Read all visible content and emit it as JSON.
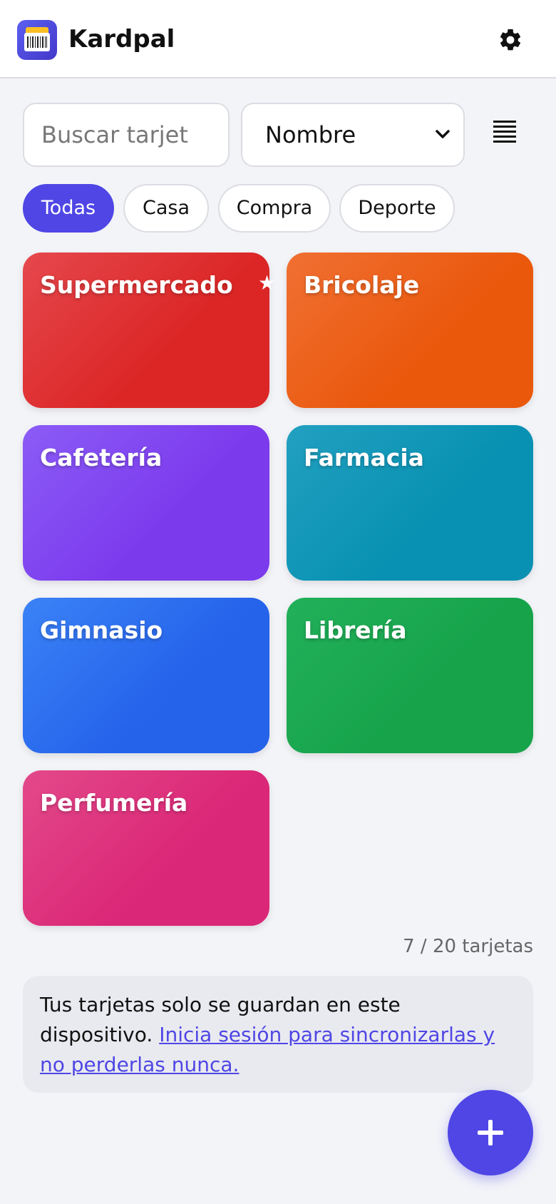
{
  "header": {
    "app_title": "Kardpal",
    "logo_icon": "wallet-card-icon",
    "settings_icon": "gear-icon"
  },
  "search": {
    "placeholder": "Buscar tarjet"
  },
  "sort": {
    "selected": "Nombre"
  },
  "view_toggle_icon": "list-view-icon",
  "filters": [
    {
      "label": "Todas",
      "active": true
    },
    {
      "label": "Casa",
      "active": false
    },
    {
      "label": "Compra",
      "active": false
    },
    {
      "label": "Deporte",
      "active": false
    }
  ],
  "cards": [
    {
      "name": "Supermercado",
      "favorite": true,
      "color_from": "#e5484d",
      "color_to": "#dc2626"
    },
    {
      "name": "Bricolaje",
      "favorite": false,
      "color_from": "#f07033",
      "color_to": "#ea580c"
    },
    {
      "name": "Cafetería",
      "favorite": false,
      "color_from": "#8b5cf6",
      "color_to": "#7c3aed"
    },
    {
      "name": "Farmacia",
      "favorite": false,
      "color_from": "#22a0c0",
      "color_to": "#0891b2"
    },
    {
      "name": "Gimnasio",
      "favorite": false,
      "color_from": "#3b82f6",
      "color_to": "#2563eb"
    },
    {
      "name": "Librería",
      "favorite": false,
      "color_from": "#22b05a",
      "color_to": "#16a34a"
    },
    {
      "name": "Perfumería",
      "favorite": false,
      "color_from": "#e3498a",
      "color_to": "#db2777"
    }
  ],
  "favorite_symbol": "★",
  "count_text": "7 / 20 tarjetas",
  "notice": {
    "text": "Tus tarjetas solo se guardan en este dispositivo. ",
    "link_text": "Inicia sesión para sincronizarlas y no perderlas nunca."
  },
  "fab_icon": "plus-icon",
  "accent_color": "#4f46e5"
}
